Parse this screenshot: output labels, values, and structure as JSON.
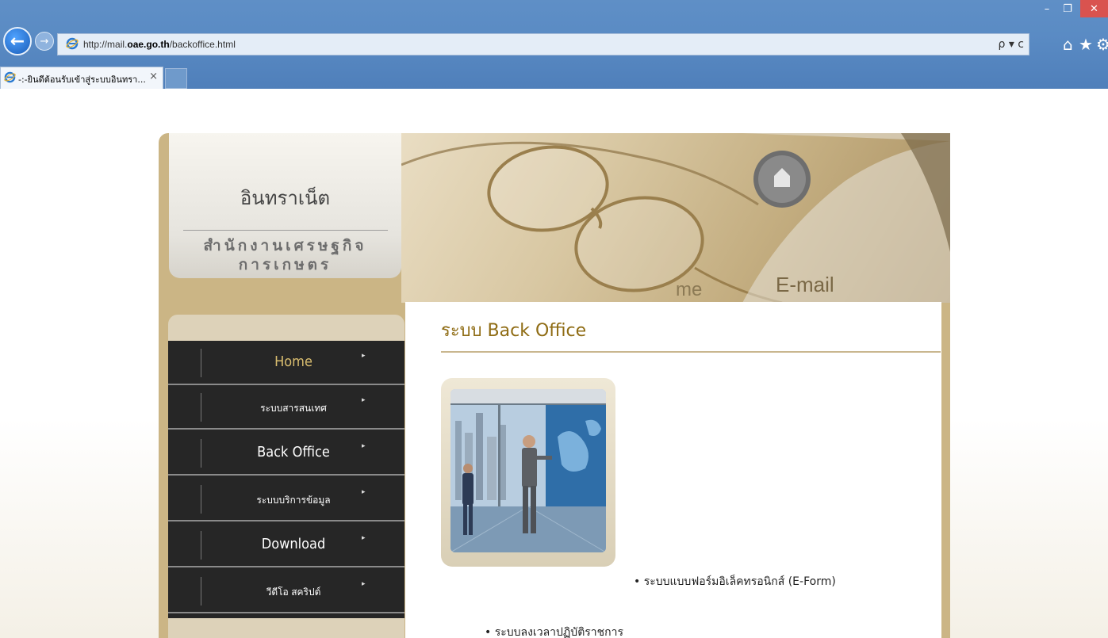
{
  "browser": {
    "url_prefix": "http://mail.",
    "url_host": "oae.go.th",
    "url_path": "/backoffice.html",
    "search_controls": "ρ ▾ c",
    "tab_title": "-:-ยินดีต้อนรับเข้าสู่ระบบอินทรา...",
    "tab_close": "×",
    "window_min": "–",
    "window_max": "❐",
    "window_close": "✕",
    "home_glyph": "⌂",
    "star_glyph": "★",
    "gear_glyph": "⚙",
    "back_glyph": "←",
    "forward_glyph": "→"
  },
  "site": {
    "logo_title": "อินทราเน็ต",
    "logo_subtitle": "สำนักงานเศรษฐกิจการเกษตร",
    "banner_text_1": "me",
    "banner_text_2": "E-mail",
    "nav": [
      {
        "label": "Home",
        "active": true
      },
      {
        "label": "ระบบสารสนเทศ",
        "active": false
      },
      {
        "label": "Back Office",
        "active": false
      },
      {
        "label": "ระบบบริการข้อมูล",
        "active": false
      },
      {
        "label": "Download",
        "active": false
      },
      {
        "label": "วีดีโอ สคริปต์",
        "active": false
      }
    ],
    "nav_arrow": "▸",
    "content_title": "ระบบ Back Office",
    "links": [
      "• ระบบแบบฟอร์มอิเล็คทรอนิกส์ (E-Form)",
      "• ระบบลงเวลาปฏิบัติราชการ"
    ]
  }
}
